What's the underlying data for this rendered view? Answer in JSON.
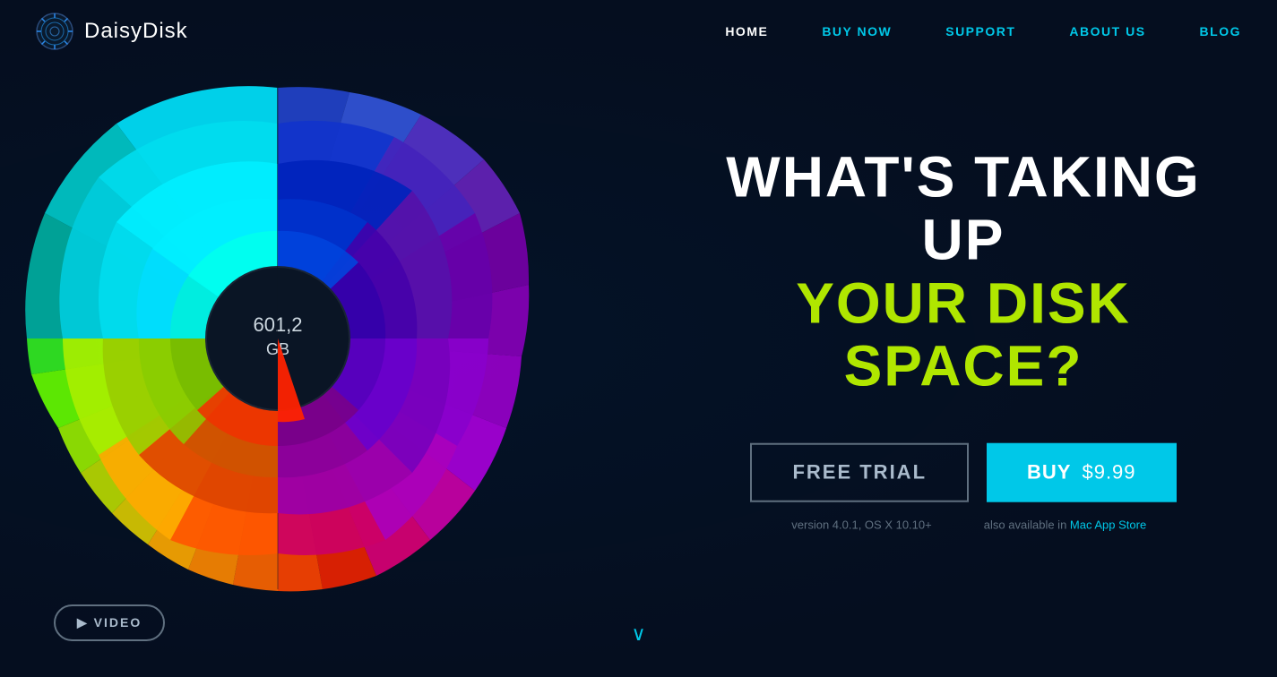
{
  "nav": {
    "logo_text": "DaisyDisk",
    "links": [
      {
        "label": "HOME",
        "active": true
      },
      {
        "label": "BUY NOW",
        "active": false
      },
      {
        "label": "SUPPORT",
        "active": false
      },
      {
        "label": "ABOUT US",
        "active": false
      },
      {
        "label": "BLOG",
        "active": false
      }
    ]
  },
  "hero": {
    "title_white": "WHAT'S TAKING UP",
    "title_green": "YOUR DISK SPACE?",
    "disk_center_label": "601,2",
    "disk_center_unit": "GB",
    "btn_free_trial": "FREE TRIAL",
    "btn_buy_label": "BUY",
    "btn_buy_price": "$9.99",
    "sub_version": "version 4.0.1, OS X 10.10+",
    "sub_store_prefix": "also available in ",
    "sub_store_link": "Mac App Store"
  },
  "video_btn": "▶ VIDEO",
  "scroll_arrow": "∨",
  "colors": {
    "accent": "#00c8e8",
    "green_title": "#b0e600",
    "bg": "#050e1f"
  }
}
